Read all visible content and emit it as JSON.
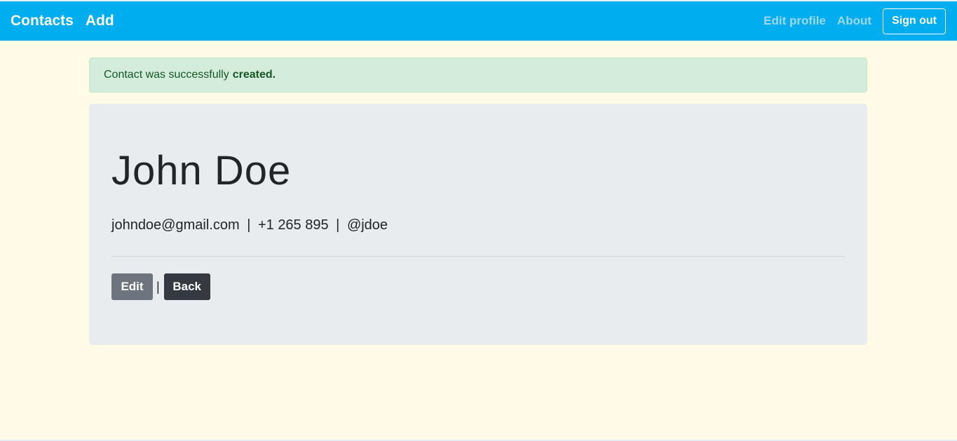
{
  "navbar": {
    "brand": "Contacts",
    "add": "Add",
    "edit_profile": "Edit profile",
    "about": "About",
    "sign_out": "Sign out"
  },
  "alert": {
    "message": "Contact was successfully",
    "emphasis": "created."
  },
  "contact": {
    "name": "John Doe",
    "email": "johndoe@gmail.com",
    "phone": "+1 265 895",
    "handle": "@jdoe",
    "separator": "|"
  },
  "actions": {
    "edit_label": "Edit",
    "separator": "|",
    "back_label": "Back"
  },
  "colors": {
    "navbar": "#00adef",
    "page_background": "#fffbe6",
    "alert_background": "#d4ecdc",
    "card_background": "#e9ecef",
    "edit_button": "#6c757d",
    "back_button": "#343a40"
  }
}
